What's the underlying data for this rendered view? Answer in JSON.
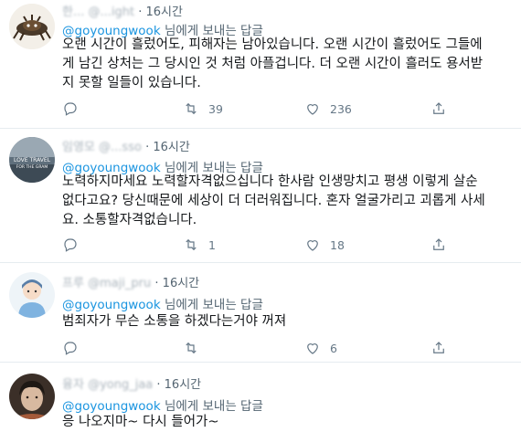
{
  "tweets": [
    {
      "name": "한...",
      "handle": "@...ight",
      "time": "16시간",
      "reply_to": "@goyoungwook",
      "reply_suffix": "님에게 보내는 답글",
      "lines": [
        "오랜 시간이 흘렀어도, 피해자는 남아있습니다. 오랜 시간이 흘렀어도 그들에",
        "게 남긴 상처는 그 당시인 것 처럼 아플겁니다. 더 오랜 시간이 흘러도 용서받",
        "지 못할 일들이 있습니다."
      ],
      "retweets": "39",
      "likes": "236"
    },
    {
      "name": "임영모",
      "handle": "@...sso",
      "time": "16시간",
      "reply_to": "@goyoungwook",
      "reply_suffix": "님에게 보내는 답글",
      "lines": [
        "노력하지마세요 노력할자격없으십니다 한사람 인생망치고 평생 이렇게 살순",
        "없다고요? 당신때문에 세상이 더 더러워집니다. 혼자 얼굴가리고 괴롭게 사세",
        "요. 소통할자격없습니다."
      ],
      "avatar_text_1": "LOVE TRAVEL",
      "avatar_text_2": "FOR THE GRAM",
      "retweets": "1",
      "likes": "18"
    },
    {
      "name": "프루",
      "handle": "@maji_pru",
      "time": "16시간",
      "reply_to": "@goyoungwook",
      "reply_suffix": "님에게 보내는 답글",
      "lines": [
        "범죄자가 무슨 소통을 하겠다는거야 꺼져"
      ],
      "retweets": "",
      "likes": "6"
    },
    {
      "name": "융자",
      "handle": "@yong_jaa",
      "time": "16시간",
      "reply_to": "@goyoungwook",
      "reply_suffix": "님에게 보내는 답글",
      "lines": [
        "응 나오지마~ 다시 들어가~"
      ]
    }
  ],
  "icons": {
    "reply": "reply-icon",
    "retweet": "retweet-icon",
    "like": "heart-icon",
    "share": "share-icon"
  },
  "colors": {
    "link": "#1b95e0",
    "muted": "#657786",
    "divider": "#e6ecf0"
  }
}
